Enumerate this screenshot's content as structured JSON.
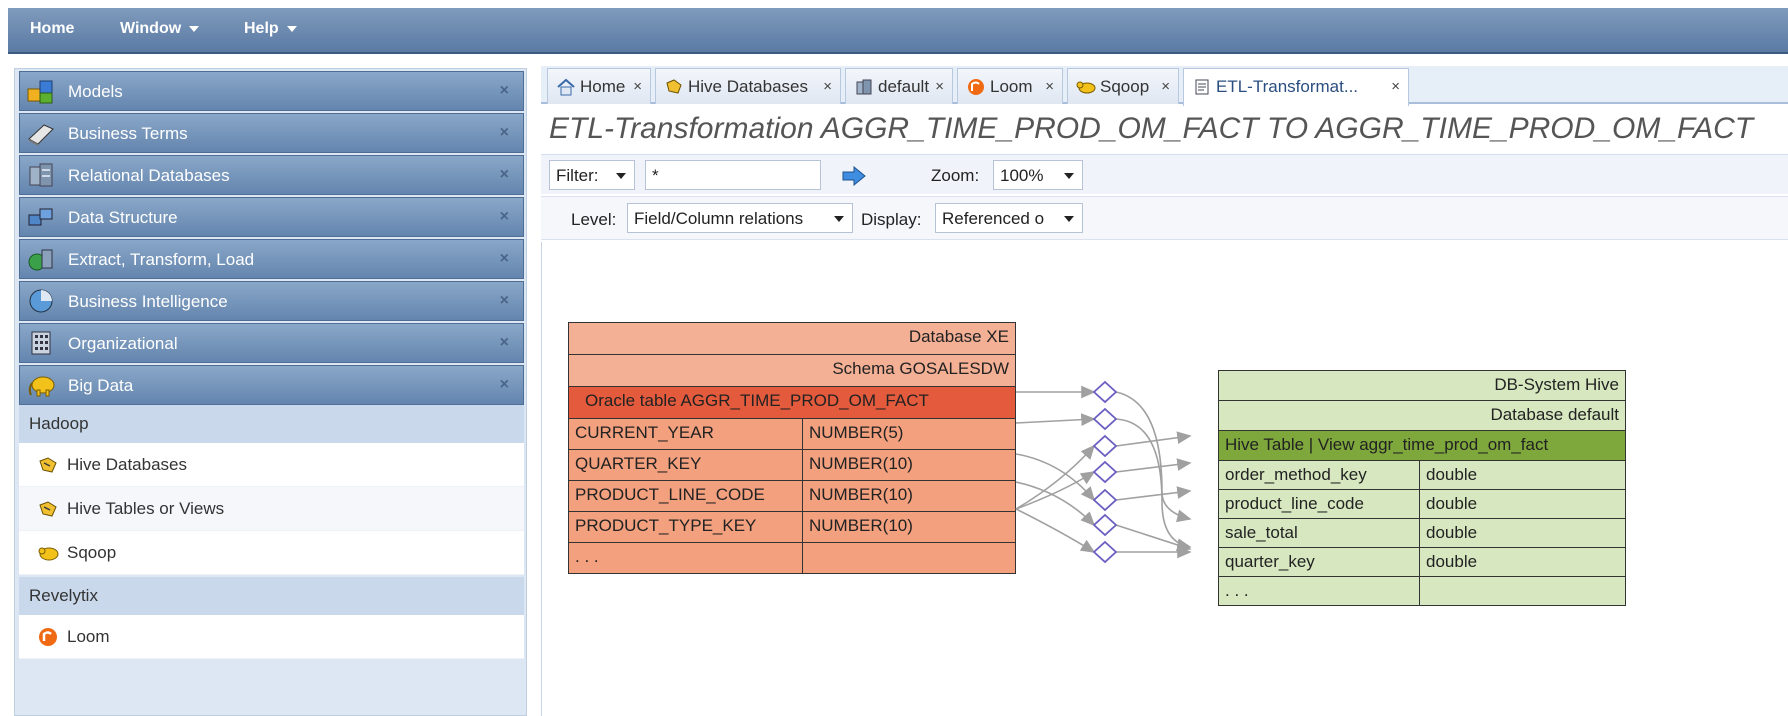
{
  "menubar": {
    "items": [
      {
        "label": "Home",
        "has_caret": false
      },
      {
        "label": "Window",
        "has_caret": true
      },
      {
        "label": "Help",
        "has_caret": true
      }
    ]
  },
  "sidebar": {
    "categories": [
      {
        "label": "Models",
        "icon": "models-icon"
      },
      {
        "label": "Business Terms",
        "icon": "book-icon"
      },
      {
        "label": "Relational Databases",
        "icon": "database-icon"
      },
      {
        "label": "Data Structure",
        "icon": "data-structure-icon"
      },
      {
        "label": "Extract, Transform, Load",
        "icon": "etl-icon"
      },
      {
        "label": "Business Intelligence",
        "icon": "bi-icon"
      },
      {
        "label": "Organizational",
        "icon": "building-icon"
      },
      {
        "label": "Big Data",
        "icon": "elephant-icon"
      }
    ],
    "close_glyph": "×",
    "groups": [
      {
        "title": "Hadoop",
        "items": [
          {
            "label": "Hive Databases",
            "icon": "hive-icon"
          },
          {
            "label": "Hive Tables or Views",
            "icon": "hive-icon"
          },
          {
            "label": "Sqoop",
            "icon": "sqoop-icon"
          }
        ]
      },
      {
        "title": "Revelytix",
        "items": [
          {
            "label": "Loom",
            "icon": "loom-icon"
          }
        ]
      }
    ]
  },
  "tabs": [
    {
      "label": "Home",
      "icon": "home-icon",
      "active": false
    },
    {
      "label": "Hive Databases",
      "icon": "hive-icon",
      "active": false
    },
    {
      "label": "default",
      "icon": "database-icon",
      "active": false
    },
    {
      "label": "Loom",
      "icon": "loom-icon",
      "active": false
    },
    {
      "label": "Sqoop",
      "icon": "sqoop-icon",
      "active": false
    },
    {
      "label": "ETL-Transformat...",
      "icon": "document-icon",
      "active": true
    }
  ],
  "page": {
    "title": "ETL-Transformation AGGR_TIME_PROD_OM_FACT TO AGGR_TIME_PROD_OM_FACT"
  },
  "filter": {
    "select_label": "Filter:",
    "value": "*",
    "zoom_label": "Zoom:",
    "zoom_value": "100%"
  },
  "level": {
    "label": "Level:",
    "value": "Field/Column relations",
    "display_label": "Display:",
    "display_value": "Referenced o"
  },
  "source": {
    "database": "Database XE",
    "schema": "Schema GOSALESDW",
    "table": "Oracle table AGGR_TIME_PROD_OM_FACT",
    "columns": [
      {
        "name": "CURRENT_YEAR",
        "type": "NUMBER(5)"
      },
      {
        "name": "QUARTER_KEY",
        "type": "NUMBER(10)"
      },
      {
        "name": "PRODUCT_LINE_CODE",
        "type": "NUMBER(10)"
      },
      {
        "name": "PRODUCT_TYPE_KEY",
        "type": "NUMBER(10)"
      },
      {
        "name": ". . .",
        "type": ""
      }
    ]
  },
  "target": {
    "system": "DB-System Hive",
    "database": "Database default",
    "table": "Hive Table | View aggr_time_prod_om_fact",
    "columns": [
      {
        "name": "order_method_key",
        "type": "double"
      },
      {
        "name": "product_line_code",
        "type": "double"
      },
      {
        "name": "sale_total",
        "type": "double"
      },
      {
        "name": "quarter_key",
        "type": "double"
      },
      {
        "name": ". . .",
        "type": ""
      }
    ]
  },
  "colors": {
    "menubar": "#6a87ad",
    "source_row": "#f2a07e",
    "source_table_header": "#e35b3c",
    "target_row": "#d7e8c0",
    "target_table_header": "#7fa83c",
    "connector_line": "#a0a0a0",
    "connector_node": "#6a5fc0"
  }
}
